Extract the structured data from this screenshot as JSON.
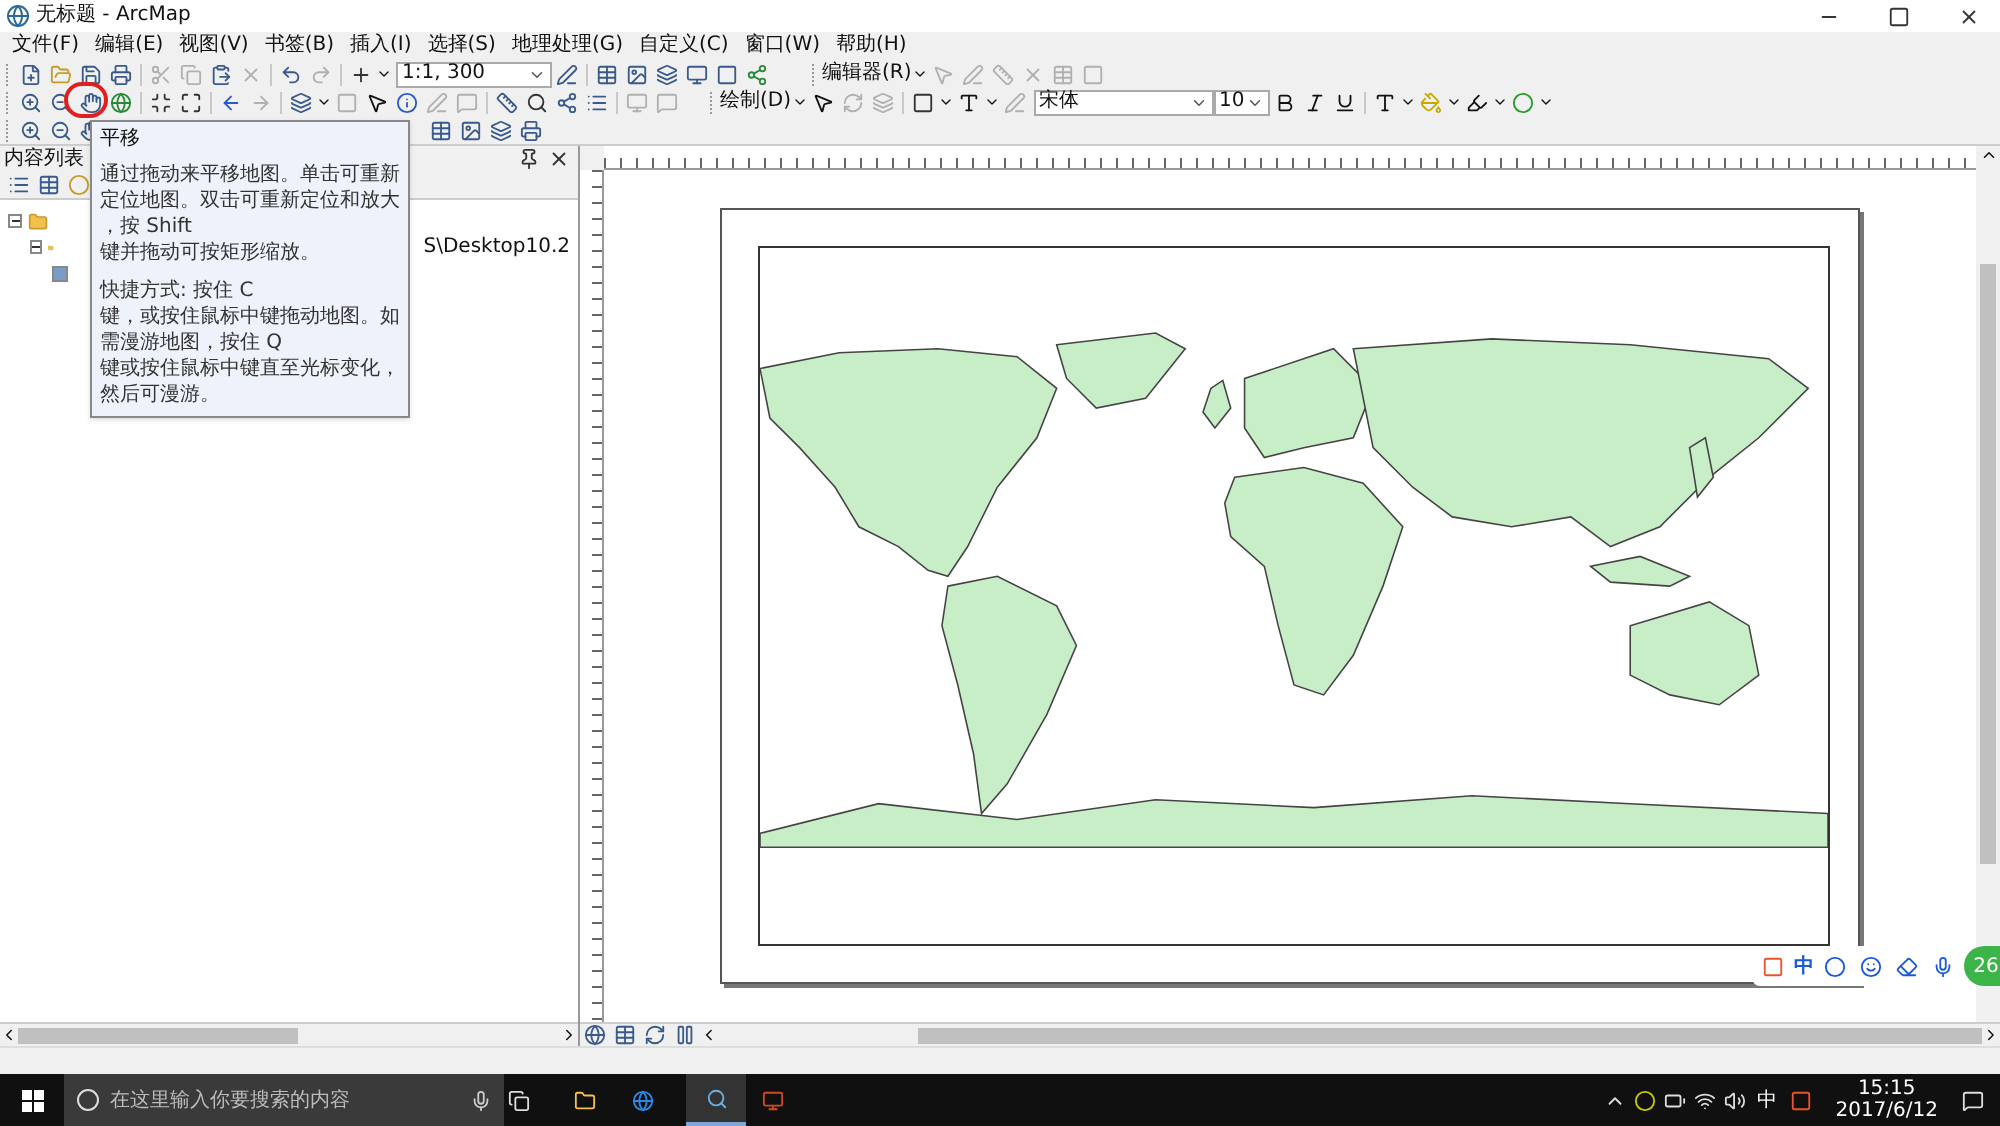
{
  "window": {
    "title": "无标题 - ArcMap"
  },
  "menu": [
    "文件(F)",
    "编辑(E)",
    "视图(V)",
    "书签(B)",
    "插入(I)",
    "选择(S)",
    "地理处理(G)",
    "自定义(C)",
    "窗口(W)",
    "帮助(H)"
  ],
  "toolbar": {
    "scale": "1:1, 300",
    "editor_menu": "编辑器(R)",
    "draw_menu": "绘制(D)",
    "font": "宋体",
    "font_size": "10"
  },
  "tooltip": {
    "title": "平移",
    "paragraphs": [
      [
        "通过拖动来平移地图。单击可重新",
        "定位地图。双击可重新定位和放大",
        "，按 Shift",
        "键并拖动可按矩形缩放。"
      ],
      [
        "快捷方式: 按住 C",
        "键，或按住鼠标中键拖动地图。如",
        "需漫游地图，按住 Q",
        "键或按住鼠标中键直至光标变化，",
        "然后可漫游。"
      ]
    ]
  },
  "toc": {
    "title": "内容列表",
    "items": [
      {
        "expanded": true,
        "children": [
          {
            "label": "S\\Desktop10.2",
            "expanded": true,
            "children": [
              {
                "checked": true
              }
            ]
          }
        ]
      }
    ]
  },
  "ime_bar": {
    "mode": "中",
    "badge": "26"
  },
  "taskbar": {
    "search_placeholder": "在这里输入你要搜索的内容",
    "tray_ime": "中",
    "time": "15:15",
    "date": "2017/6/12"
  }
}
